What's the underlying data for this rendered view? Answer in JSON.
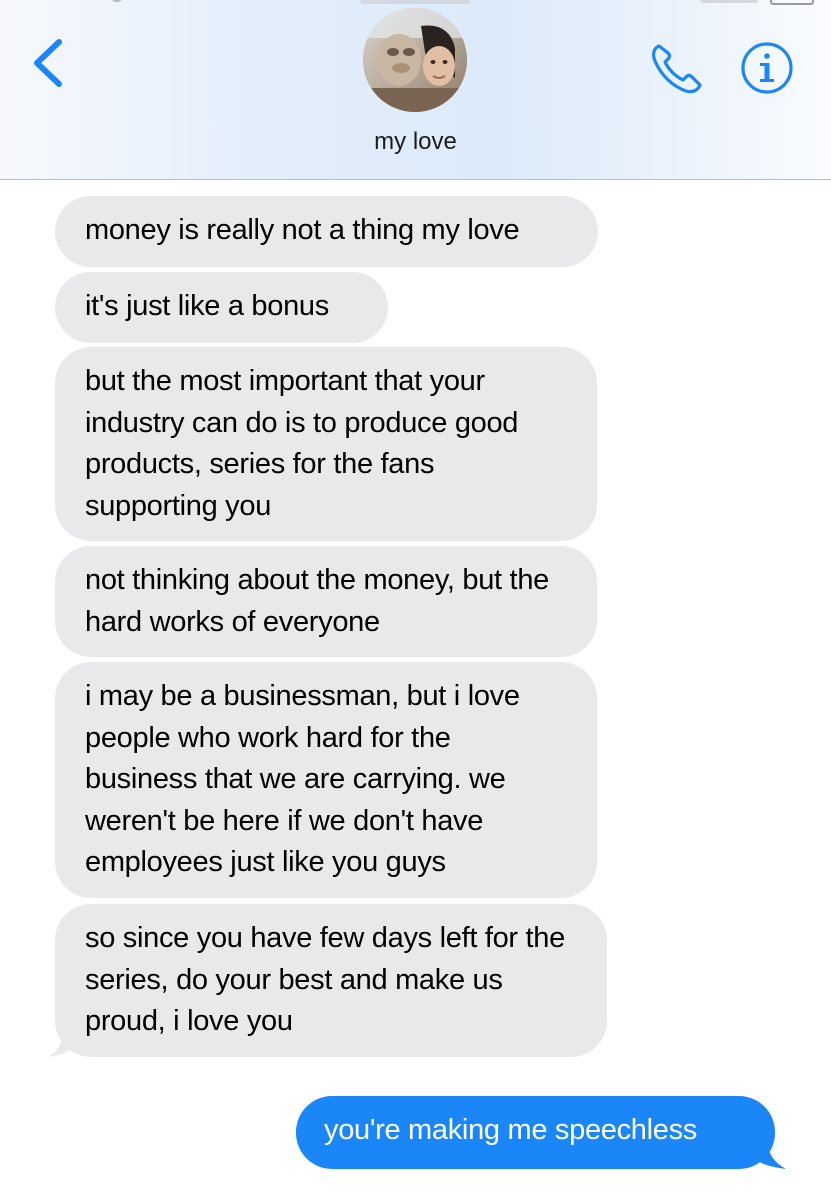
{
  "header": {
    "contact_name": "my love",
    "icons": {
      "back": "chevron-left-icon",
      "call": "phone-icon",
      "info": "info-icon"
    },
    "accent_color": "#1a86f8"
  },
  "messages": [
    {
      "direction": "incoming",
      "text": "money is really not a thing my love"
    },
    {
      "direction": "incoming",
      "text": "it's just like a bonus"
    },
    {
      "direction": "incoming",
      "text": "but the most important that your industry can do is to produce good products, series for the fans supporting you"
    },
    {
      "direction": "incoming",
      "text": "not thinking about the money, but the hard works of everyone"
    },
    {
      "direction": "incoming",
      "text": "i may be a businessman, but i love people who work hard for the business that we are carrying. we weren't be here if we don't have employees just like you guys"
    },
    {
      "direction": "incoming",
      "text": "so since you have few days left for the series, do your best and make us proud, i love you"
    },
    {
      "direction": "outgoing",
      "text": "you're making me speechless"
    }
  ],
  "colors": {
    "incoming_bubble": "#e9e9eb",
    "outgoing_bubble": "#1a86f8",
    "outgoing_text": "#ffffff"
  }
}
